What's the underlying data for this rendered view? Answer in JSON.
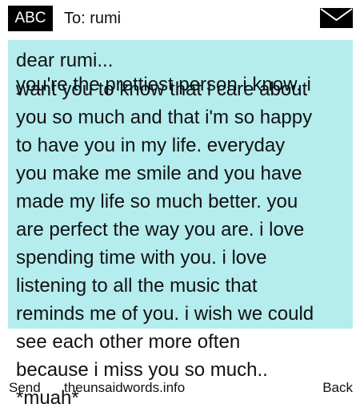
{
  "header": {
    "mode_badge": "ABC",
    "to_label": "To: rumi",
    "icon": "envelope-icon"
  },
  "message": {
    "greeting": "dear rumi...",
    "line_overlap_top": "you're the prettiest person i know. i",
    "line_overlap_bottom": "want you to know that i care about",
    "lines": [
      "you so much and that i'm so happy",
      "to have you in my life. everyday",
      "you make me smile and you have",
      "made my life so much better. you",
      "are perfect the way you are. i love",
      "spending time with you. i love",
      "listening to all the music that",
      "reminds me of you. i wish we could",
      "see each other more often",
      "because i miss you so much..",
      "*muah*"
    ],
    "background_color": "#b5ecee"
  },
  "footer": {
    "send_label": "Send",
    "watermark": "theunsaidwords.info",
    "back_label": "Back"
  }
}
